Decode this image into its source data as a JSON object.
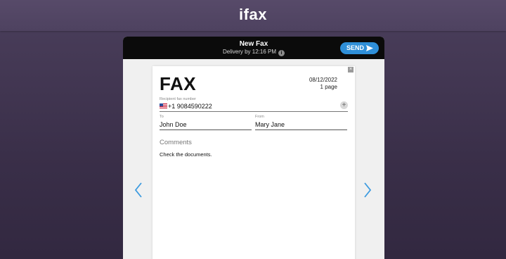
{
  "app": {
    "logo_text": "ifax"
  },
  "header": {
    "title": "New Fax",
    "delivery": "Delivery by 12:16 PM",
    "info_icon": "info-icon",
    "send_label": "SEND",
    "send_icon": "paper-plane-icon",
    "accent": "#2f8fd8"
  },
  "fax": {
    "title": "FAX",
    "date": "08/12/2022",
    "pages": "1 page",
    "recipient_label": "Recipient fax number",
    "recipient_flag": "us-flag-icon",
    "recipient_number": "+1 9084590222",
    "to_label": "To",
    "to_value": "John Doe",
    "from_label": "From",
    "from_value": "Mary Jane",
    "comments_label": "Comments",
    "comments_value": "Check the documents."
  },
  "nav": {
    "prev_icon": "chevron-left-icon",
    "next_icon": "chevron-right-icon"
  }
}
